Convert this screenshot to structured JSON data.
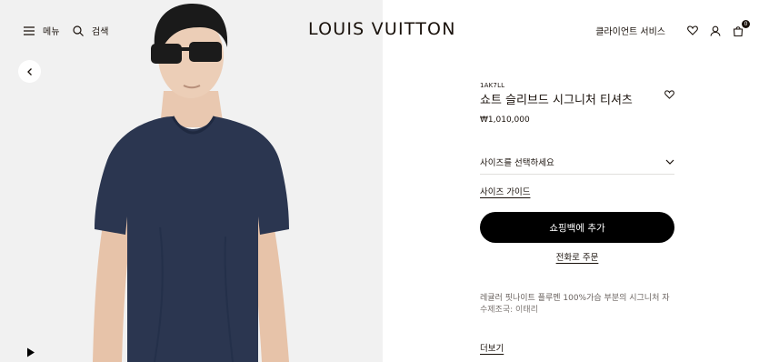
{
  "header": {
    "menu_label": "메뉴",
    "search_label": "검색",
    "logo": "LOUIS VUITTON",
    "client_service_label": "클라이언트 서비스",
    "cart_count": "0"
  },
  "product": {
    "sku": "1AK7LL",
    "name": "쇼트 슬리브드 시그니처 티셔츠",
    "price": "₩1,010,000",
    "size_select_label": "사이즈를 선택하세요",
    "size_guide_label": "사이즈 가이드",
    "add_to_bag_label": "쇼핑백에 추가",
    "phone_order_label": "전화로 주문",
    "description": "레귤러 핏나이트 플루멘 100%가슴 부분의 시그니처 자수제조국: 이태리",
    "more_label": "더보기"
  },
  "colors": {
    "brand_text": "#19110b",
    "button_bg": "#000000",
    "image_bg": "#f1f1f1",
    "tshirt": "#2b3650"
  },
  "icons": [
    "menu-icon",
    "search-icon",
    "heart-icon",
    "user-icon",
    "shopping-bag-icon",
    "chevron-left-icon",
    "play-icon",
    "chevron-down-icon"
  ]
}
